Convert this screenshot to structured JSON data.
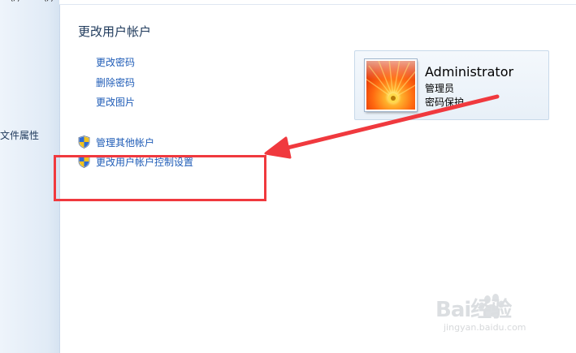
{
  "sidebar": {
    "top_text": "…(/)  ……(/)  …(…)",
    "link_file_properties": "文件属性"
  },
  "main": {
    "title": "更改用户帐户",
    "links": {
      "change_password": "更改密码",
      "remove_password": "删除密码",
      "change_picture": "更改图片",
      "manage_other_accounts": "管理其他帐户",
      "uac_settings": "更改用户帐户控制设置"
    }
  },
  "account": {
    "name": "Administrator",
    "role": "管理员",
    "status": "密码保护"
  },
  "annotations": {
    "highlight_color": "#f0393e"
  },
  "watermark": {
    "brand": "Bai经验",
    "url": "jingyan.baidu.com"
  },
  "icons": {
    "shield": "uac-shield-icon"
  }
}
